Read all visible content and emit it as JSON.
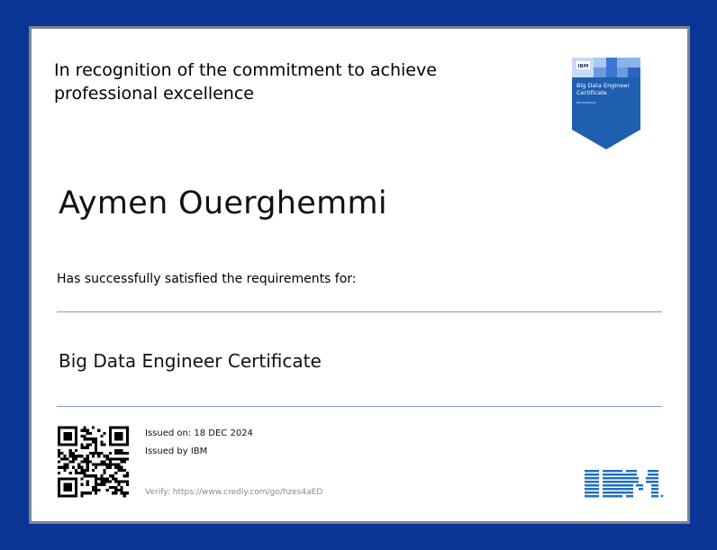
{
  "certificate": {
    "recognition_text": "In recognition of the commitment to achieve professional excellence",
    "recipient_name": "Aymen Ouerghemmi",
    "requirements_text": "Has successfully satisfied the requirements for:",
    "certificate_name": "Big Data Engineer Certificate",
    "issued_on": "Issued on: 18 DEC 2024",
    "issued_by": "Issued by IBM",
    "verify_text": "Verify: https://www.credly.com/go/hzes4aED"
  },
  "badge": {
    "brand": "IBM",
    "title_line1": "Big Data Engineer",
    "title_line2": "Certificate",
    "fine_print": "IBM SkillsBuild"
  },
  "colors": {
    "background": "#0a3596",
    "border": "#7d8490",
    "rule": "#7f9ac4",
    "badge": "#1f5fb0",
    "ibm_logo": "#1f70c1"
  },
  "icons": {
    "qr": "qr-code-icon",
    "badge": "certificate-badge-icon",
    "logo": "ibm-logo-icon"
  }
}
